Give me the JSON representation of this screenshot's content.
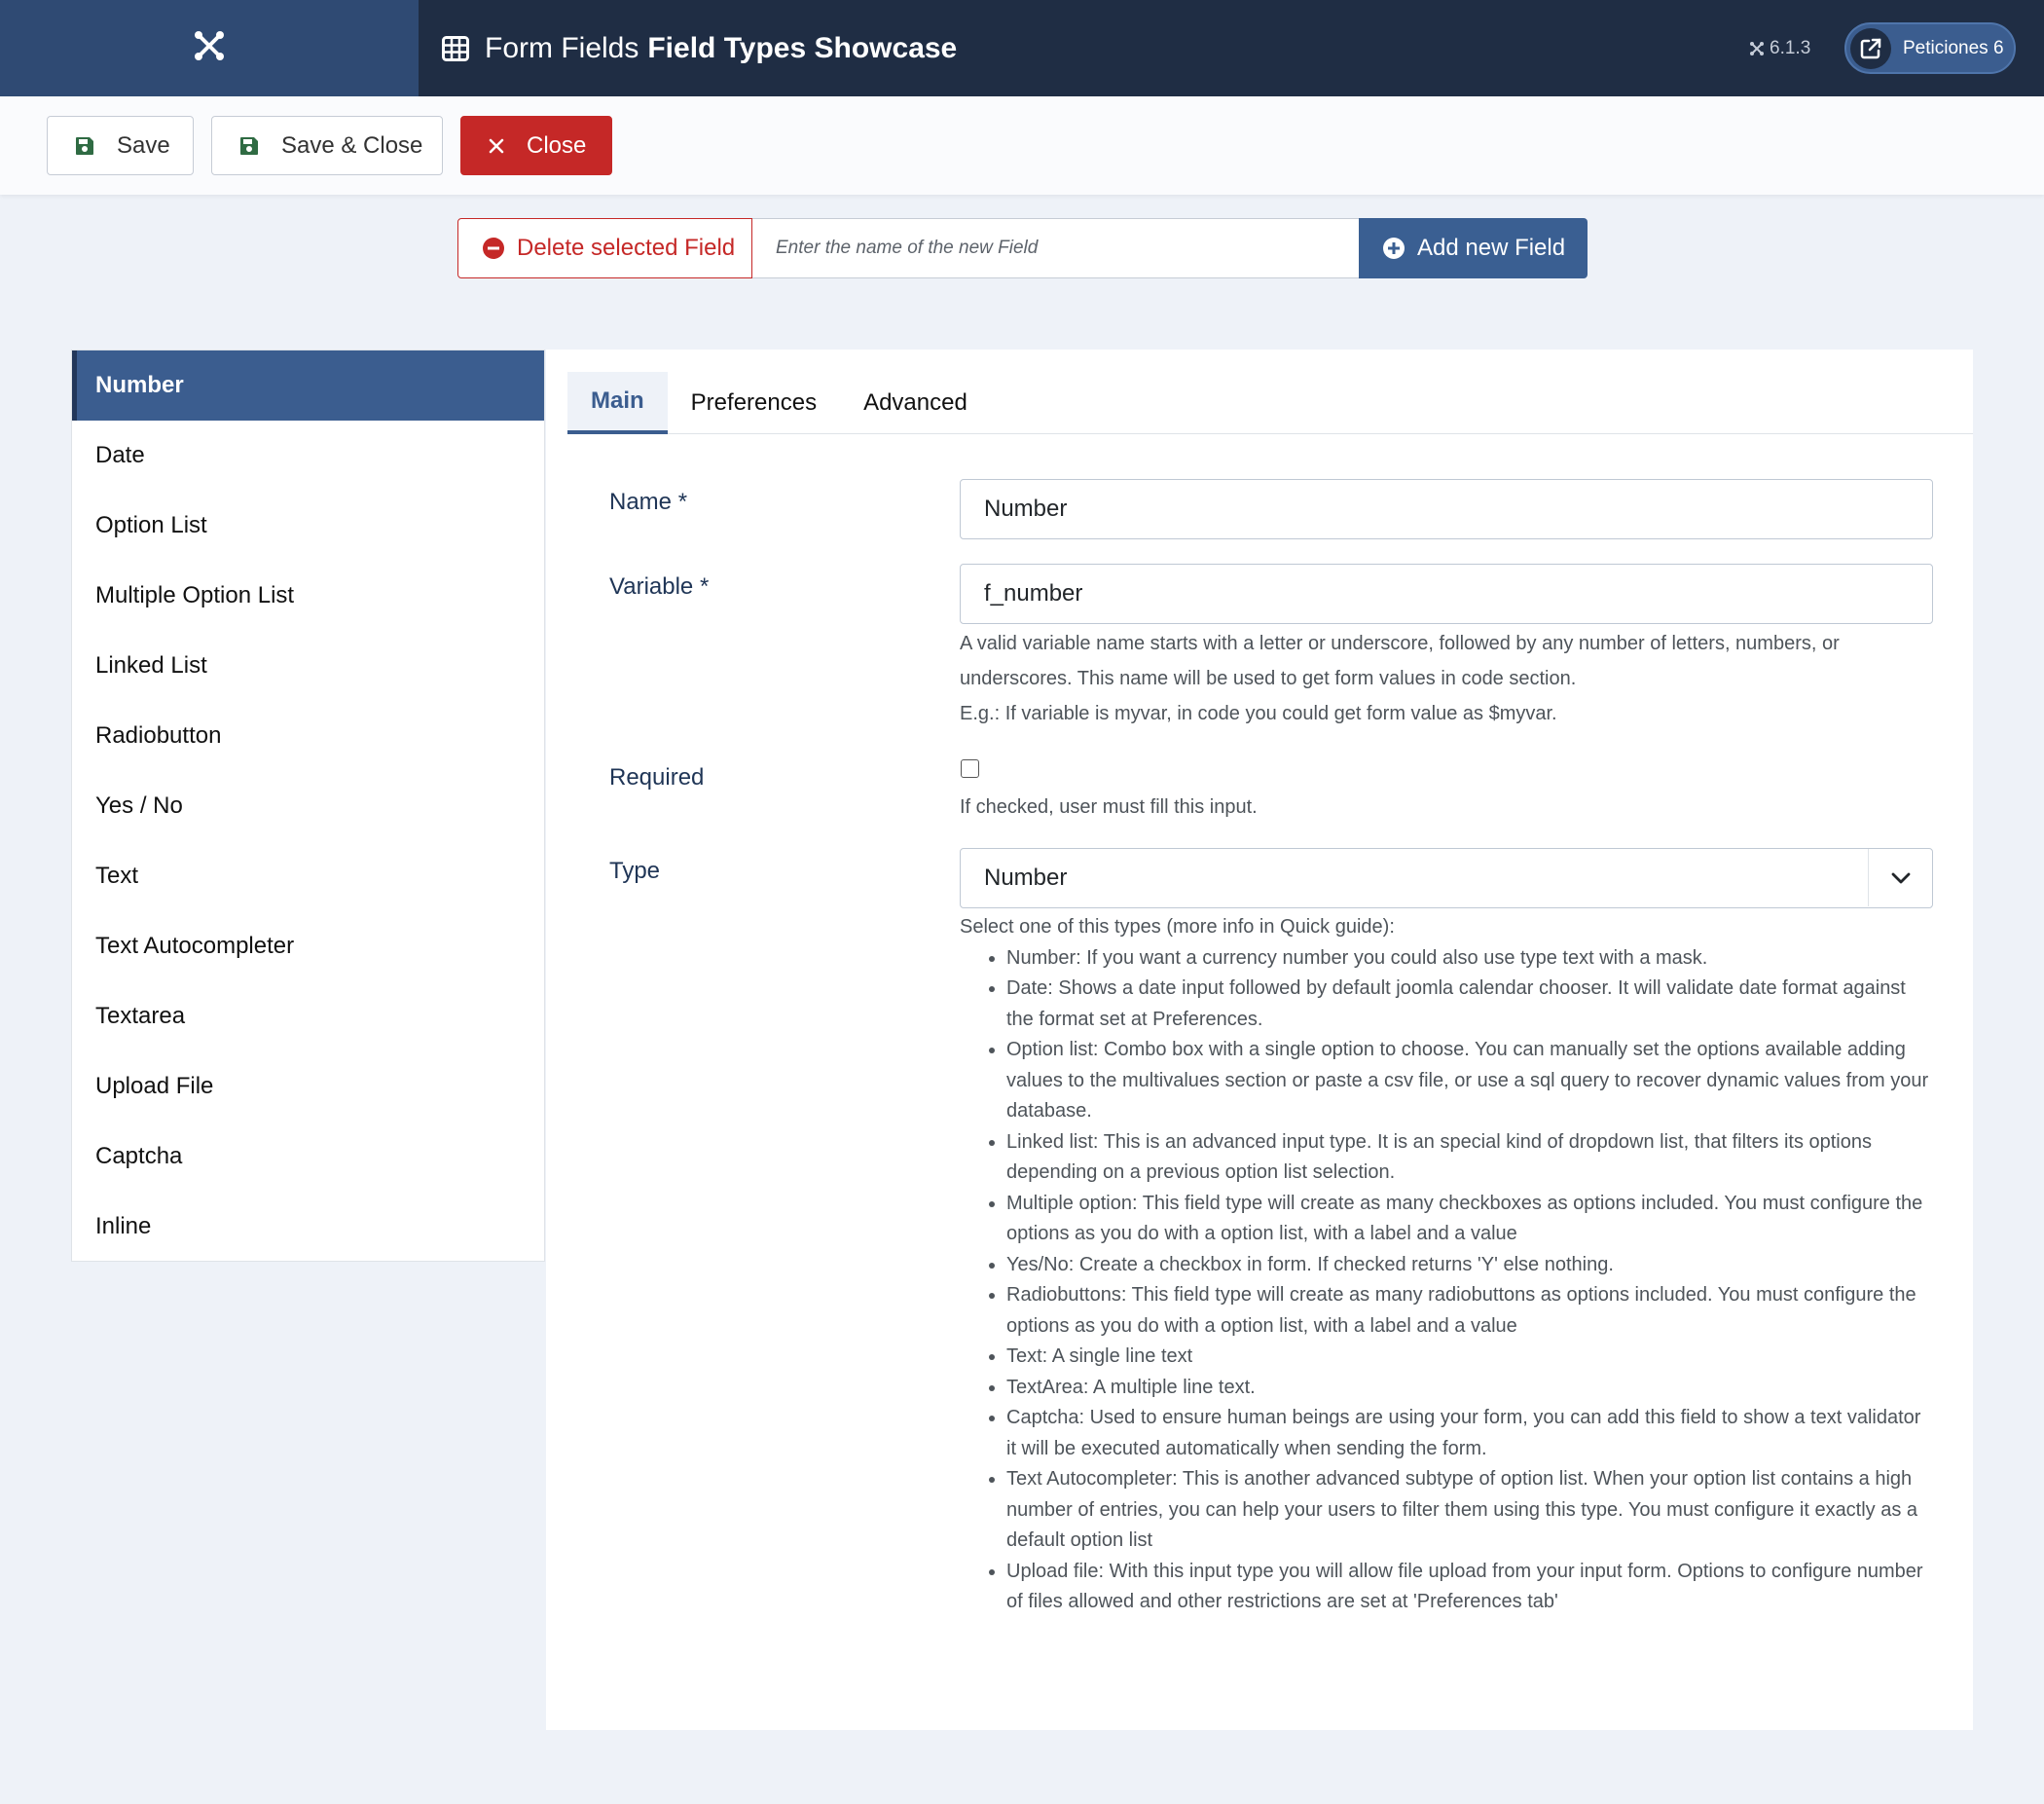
{
  "header": {
    "title_prefix": "Form Fields",
    "title_bold": "Field Types Showcase",
    "version": "6.1.3",
    "peticiones_label": "Peticiones 6",
    "logo_icon": "joomla-icon"
  },
  "toolbar": {
    "save_label": "Save",
    "save_close_label": "Save & Close",
    "close_label": "Close"
  },
  "field_actions": {
    "delete_label": "Delete selected Field",
    "new_field_placeholder": "Enter the name of the new Field",
    "add_label": "Add new Field"
  },
  "sidebar": {
    "items": [
      {
        "label": "Number"
      },
      {
        "label": "Date"
      },
      {
        "label": "Option List"
      },
      {
        "label": "Multiple Option List"
      },
      {
        "label": "Linked List"
      },
      {
        "label": "Radiobutton"
      },
      {
        "label": "Yes / No"
      },
      {
        "label": "Text"
      },
      {
        "label": "Text Autocompleter"
      },
      {
        "label": "Textarea"
      },
      {
        "label": "Upload File"
      },
      {
        "label": "Captcha"
      },
      {
        "label": "Inline"
      }
    ],
    "active_index": 0
  },
  "tabs": [
    {
      "label": "Main"
    },
    {
      "label": "Preferences"
    },
    {
      "label": "Advanced"
    }
  ],
  "form": {
    "name_label": "Name *",
    "name_value": "Number",
    "variable_label": "Variable *",
    "variable_value": "f_number",
    "variable_help_1": "A valid variable name starts with a letter or underscore, followed by any number of letters, numbers, or underscores. This name will be used to get form values in code section.",
    "variable_help_2": "E.g.: If variable is myvar, in code you could get form value as $myvar.",
    "required_label": "Required",
    "required_checked": false,
    "required_help": "If checked, user must fill this input.",
    "type_label": "Type",
    "type_value": "Number",
    "type_help_intro": "Select one of this types (more info in Quick guide):",
    "type_help_items": [
      "Number: If you want a currency number you could also use type text with a mask.",
      "Date: Shows a date input followed by default joomla calendar chooser. It will validate date format against the format set at Preferences.",
      "Option list: Combo box with a single option to choose. You can manually set the options available adding values to the multivalues section or paste a csv file, or use a sql query to recover dynamic values from your database.",
      "Linked list: This is an advanced input type. It is an special kind of dropdown list, that filters its options depending on a previous option list selection.",
      "Multiple option: This field type will create as many checkboxes as options included. You must configure the options as you do with a option list, with a label and a value",
      "Yes/No: Create a checkbox in form. If checked returns 'Y' else nothing.",
      "Radiobuttons: This field type will create as many radiobuttons as options included. You must configure the options as you do with a option list, with a label and a value",
      "Text: A single line text",
      "TextArea: A multiple line text.",
      "Captcha: Used to ensure human beings are using your form, you can add this field to show a text validator it will be executed automatically when sending the form.",
      "Text Autocompleter: This is another advanced subtype of option list. When your option list contains a high number of entries, you can help your users to filter them using this type. You must configure it exactly as a default option list",
      "Upload file: With this input type you will allow file upload from your input form. Options to configure number of files allowed and other restrictions are set at 'Preferences tab'"
    ]
  }
}
